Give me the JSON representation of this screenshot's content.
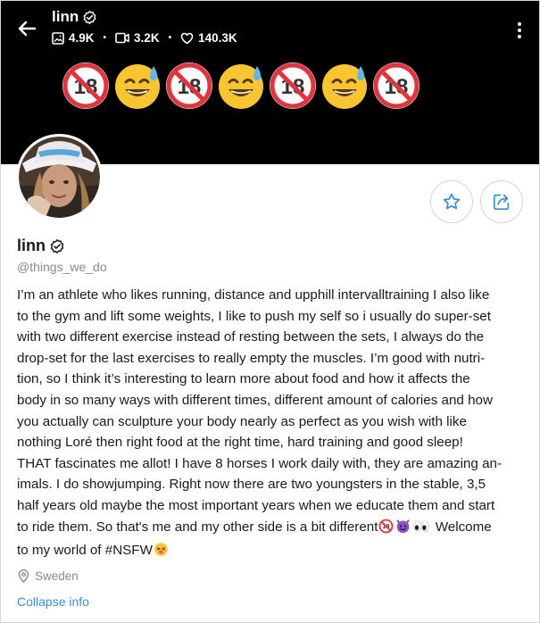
{
  "header": {
    "title": "linn",
    "stats": {
      "photos": "4.9K",
      "videos": "3.2K",
      "likes": "140.3K"
    }
  },
  "banner": {
    "emojis": [
      "no-18",
      "sweat-smile",
      "no-18",
      "sweat-smile",
      "no-18",
      "sweat-smile",
      "no-18"
    ]
  },
  "profile": {
    "name": "linn",
    "handle": "@things_we_do",
    "bio_lines": [
      "I’m an athlete who likes running, distance and upphill intervalltraining I also like",
      "to the gym and lift some weights, I like to push my self so i usually do super-set",
      "with two different exercise instead of resting between the sets, I always do the",
      "drop-set for the last exercises to really empty the muscles. I’m good with nutri-",
      "tion, so I think it’s interesting to learn more about food and how it affects the",
      "body in so many ways with different times, different amount of calories and how",
      "you actually can sculpture your body nearly as perfect as you wish with like",
      "nothing Loré then right food at the right time, hard training and good sleep!",
      "THAT fascinates me allot! I have 8 horses I work daily with, they are amazing an-",
      "imals. I do showjumping. Right now there are two youngsters in the stable, 3,5",
      "half years old maybe the most important years when we educate them and start",
      "to ride them. So that's me and my other side is a bit different",
      "Welcome",
      "to my world of #NSFW"
    ],
    "location": "Sweden",
    "collapse_label": "Collapse info"
  },
  "colors": {
    "accent": "#3a8fd4",
    "banner_bg": "#000000",
    "muted": "#8a8a8a"
  }
}
